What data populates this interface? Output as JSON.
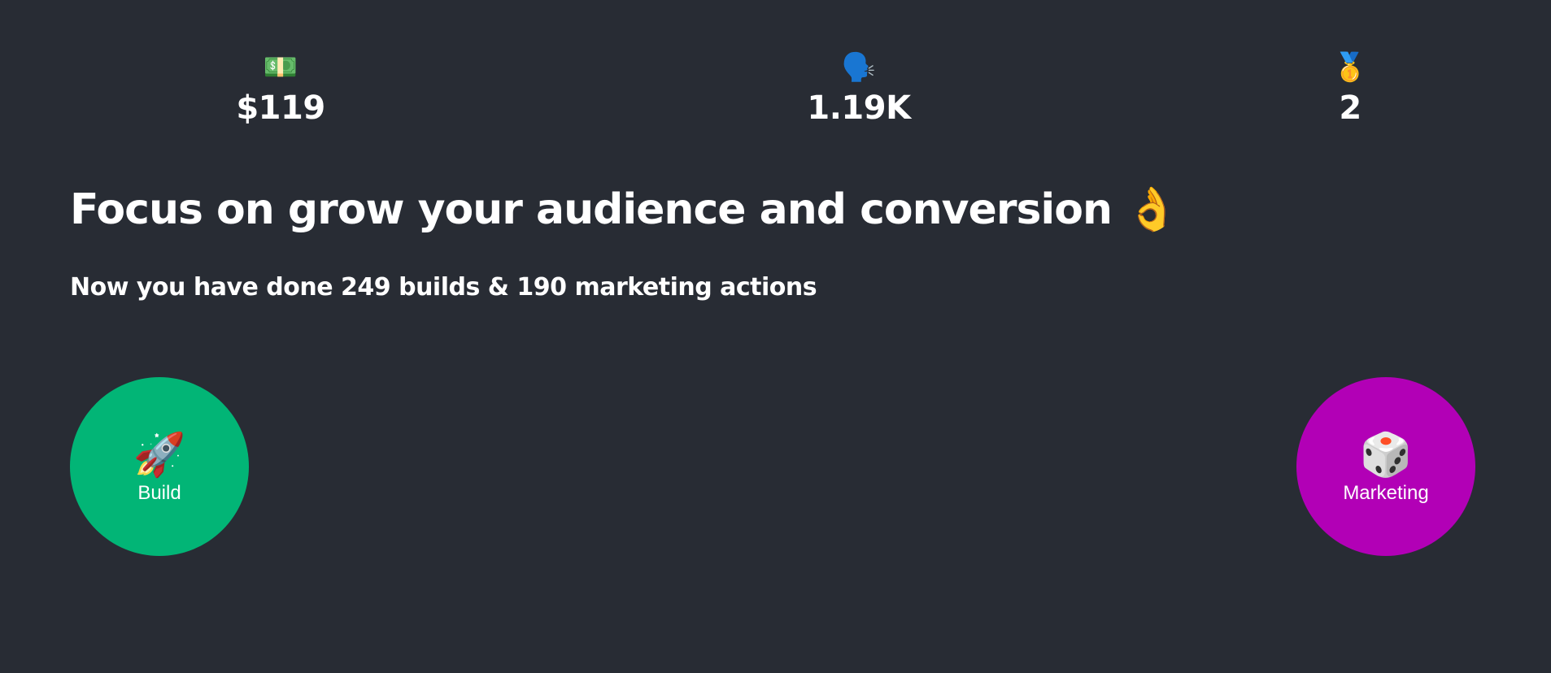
{
  "stats": [
    {
      "icon": "💵",
      "icon_name": "dollar-banknote-icon",
      "value": "$119"
    },
    {
      "icon": "🗣️",
      "icon_name": "speaking-head-icon",
      "value": "1.19K"
    },
    {
      "icon": "🥇",
      "icon_name": "medal-icon",
      "value": "2"
    }
  ],
  "headline": "Focus on grow your audience and conversion 👌",
  "subline": "Now you have done 249 builds & 190 marketing actions",
  "actions": {
    "build": {
      "icon": "🚀",
      "icon_name": "rocket-icon",
      "label": "Build",
      "color": "#02b576"
    },
    "marketing": {
      "icon": "🎲",
      "icon_name": "dice-icon",
      "label": "Marketing",
      "color": "#b200b6"
    }
  },
  "colors": {
    "background": "#282c34",
    "text": "#ffffff"
  }
}
